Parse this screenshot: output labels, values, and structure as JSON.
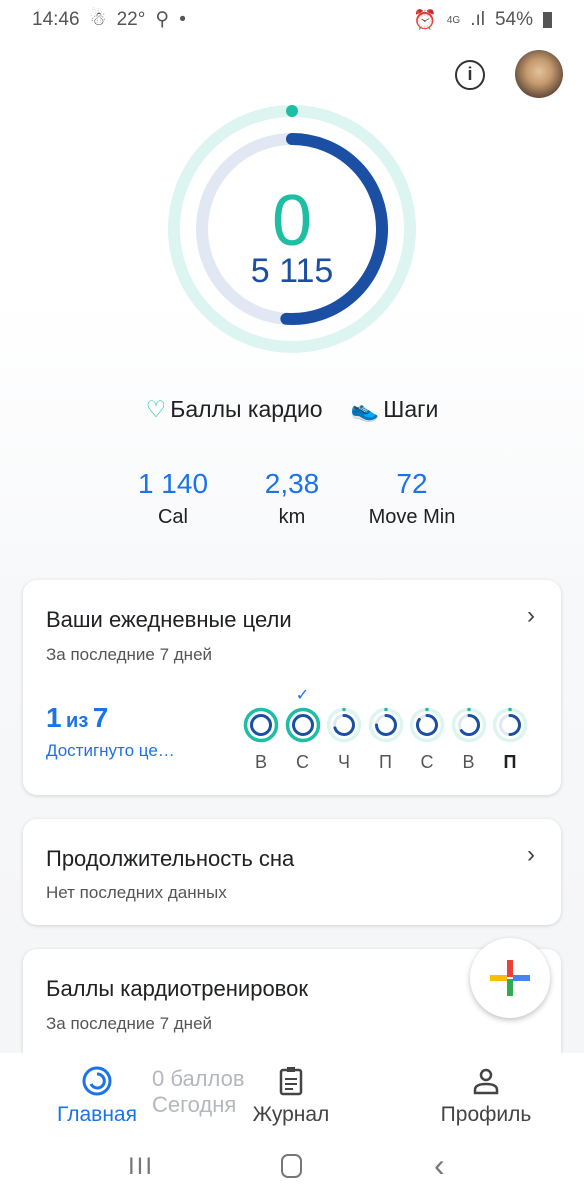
{
  "status_bar": {
    "time": "14:46",
    "temperature": "22°",
    "battery": "54%",
    "network": "4G"
  },
  "header": {
    "info_icon": "info-icon",
    "avatar": "profile-avatar"
  },
  "summary": {
    "cardio_points": "0",
    "steps": "5 115",
    "steps_progress": 0.51,
    "cardio_progress": 0.0,
    "legend": [
      {
        "label": "Баллы кардио",
        "icon": "heart-icon"
      },
      {
        "label": "Шаги",
        "icon": "shoe-icon"
      }
    ],
    "stats": [
      {
        "value": "1 140",
        "unit": "Cal"
      },
      {
        "value": "2,38",
        "unit": "km"
      },
      {
        "value": "72",
        "unit": "Move Min"
      }
    ]
  },
  "goals_card": {
    "title": "Ваши ежедневные цели",
    "subtitle": "За последние 7 дней",
    "achieved": "1",
    "of": "из",
    "total": "7",
    "achieved_label": "Достигнуто це…",
    "days": [
      {
        "label": "В",
        "outer": 1,
        "inner": 1,
        "check": false
      },
      {
        "label": "С",
        "outer": 1,
        "inner": 1,
        "check": true
      },
      {
        "label": "Ч",
        "outer": 0.02,
        "inner": 0.7
      },
      {
        "label": "П",
        "outer": 0.02,
        "inner": 0.75
      },
      {
        "label": "С",
        "outer": 0.02,
        "inner": 0.85
      },
      {
        "label": "В",
        "outer": 0.02,
        "inner": 0.65
      },
      {
        "label": "П",
        "outer": 0.02,
        "inner": 0.5
      }
    ]
  },
  "sleep_card": {
    "title": "Продолжительность сна",
    "subtitle": "Нет последних данных"
  },
  "cardio_card": {
    "title": "Баллы кардиотренировок",
    "subtitle": "За последние 7 дней",
    "ghost_value": "0 баллов",
    "ghost_sub": "Сегодня"
  },
  "colors": {
    "teal": "#1ebea5",
    "blue": "#1a4fa3",
    "accent": "#1a73e8"
  },
  "nav": [
    {
      "label": "Главная",
      "icon": "home-ring-icon",
      "active": true
    },
    {
      "label": "Журнал",
      "icon": "journal-icon"
    },
    {
      "label": "Профиль",
      "icon": "person-icon"
    }
  ]
}
